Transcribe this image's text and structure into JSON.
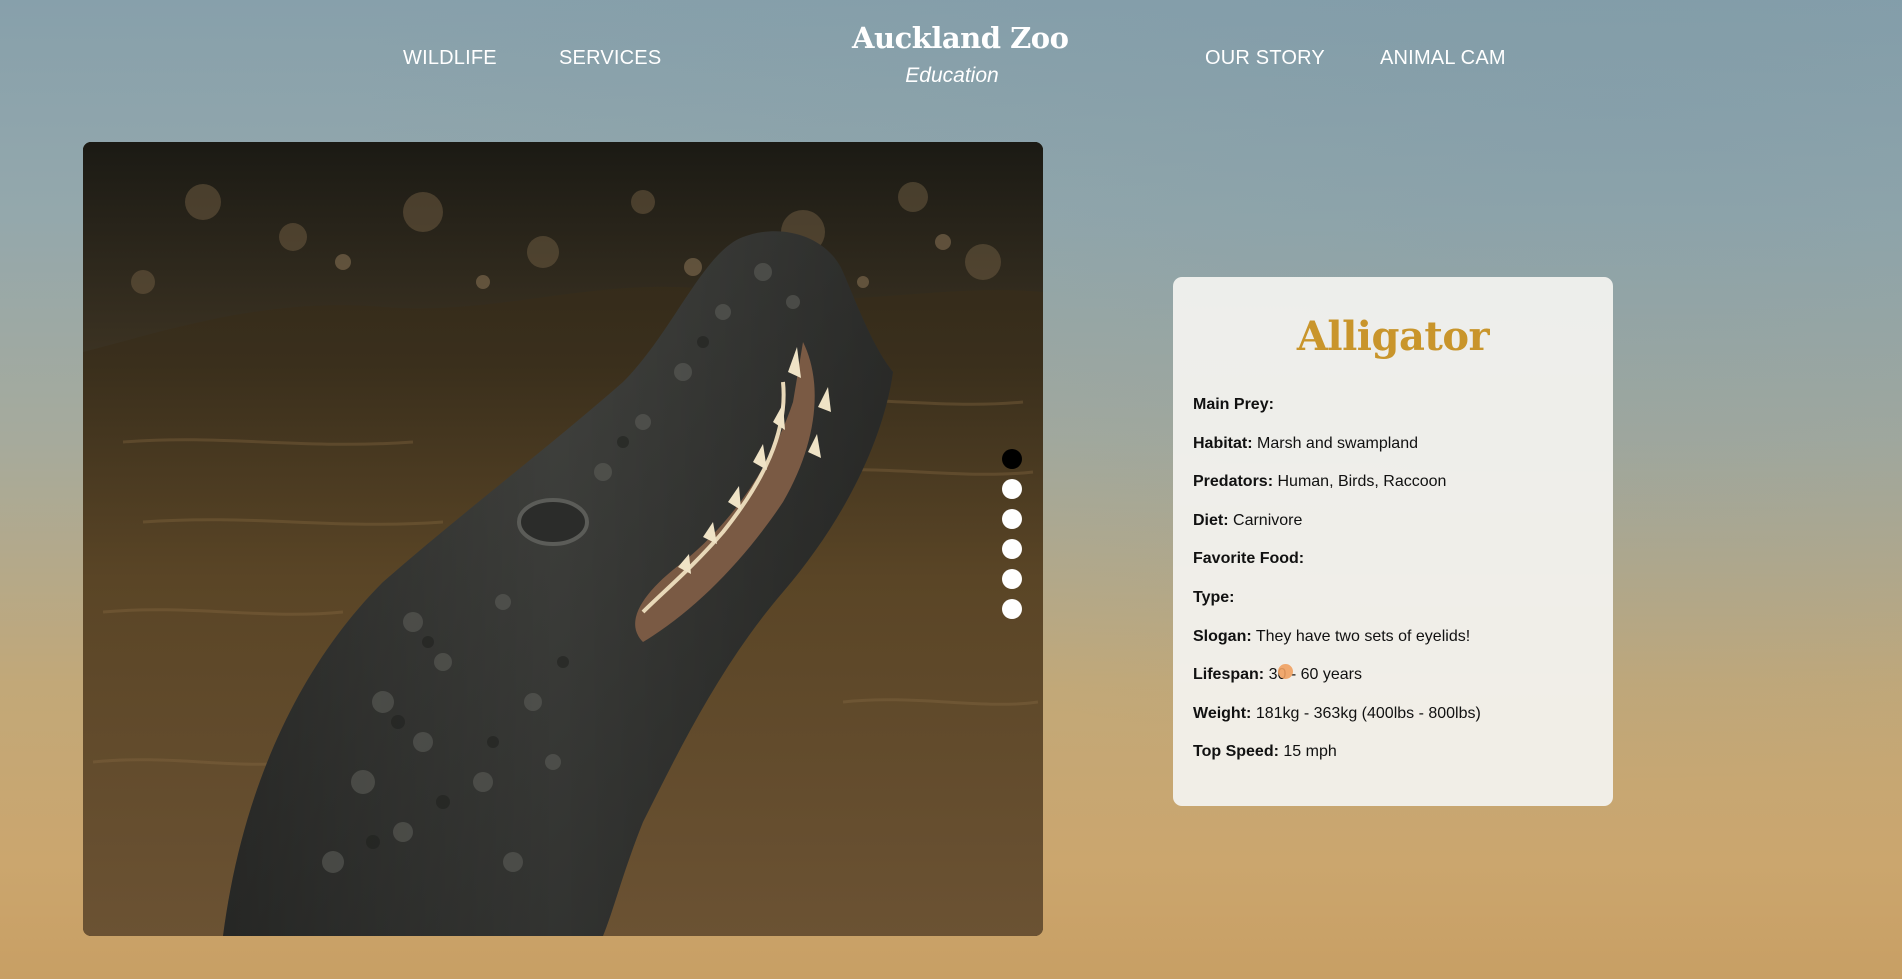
{
  "colors": {
    "accent": "#c9952b",
    "nav_text": "#ffffff",
    "active_dot": "#000000",
    "inactive_dot": "#ffffff"
  },
  "nav": {
    "left": [
      {
        "label": "WILDLIFE"
      },
      {
        "label": "SERVICES"
      }
    ],
    "right": [
      {
        "label": "OUR STORY"
      },
      {
        "label": "ANIMAL CAM"
      }
    ]
  },
  "brand": {
    "title": "Auckland Zoo",
    "subtitle": "Education"
  },
  "hero": {
    "image_subject": "alligator-photo",
    "slides_total": 6,
    "active_slide": 1
  },
  "card": {
    "title": "Alligator",
    "facts": [
      {
        "label": "Main Prey:",
        "value": ""
      },
      {
        "label": "Habitat:",
        "value": "Marsh and swampland"
      },
      {
        "label": "Predators:",
        "value": "Human, Birds, Raccoon"
      },
      {
        "label": "Diet:",
        "value": "Carnivore"
      },
      {
        "label": "Favorite Food:",
        "value": ""
      },
      {
        "label": "Type:",
        "value": ""
      },
      {
        "label": "Slogan:",
        "value": "They have two sets of eyelids!"
      },
      {
        "label": "Lifespan:",
        "value": "30 - 60 years"
      },
      {
        "label": "Weight:",
        "value": "181kg - 363kg (400lbs - 800lbs)"
      },
      {
        "label": "Top Speed:",
        "value": "15 mph"
      }
    ]
  }
}
